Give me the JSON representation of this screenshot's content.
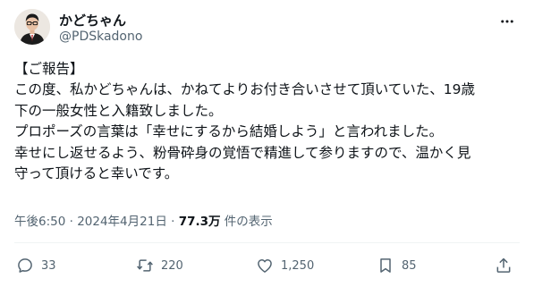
{
  "author": {
    "display_name": "かどちゃん",
    "handle": "@PDSkadono",
    "avatar_icon": "profile-photo-icon"
  },
  "tweet": {
    "lines": [
      "【ご報告】",
      "この度、私かどちゃんは、かねてよりお付き合いさせて頂いていた、19歳",
      "下の一般女性と入籍致しました。",
      "プロポーズの言葉は「幸せにするから結婚しよう」と言われました。",
      "幸せにし返せるよう、粉骨砕身の覚悟で精進して参りますので、温かく見",
      "守って頂けると幸いです。"
    ]
  },
  "meta": {
    "timestamp": "午後6:50 · 2024年4月21日",
    "separator": " · ",
    "views": "77.3万",
    "views_label": " 件の表示"
  },
  "actions": {
    "replies": "33",
    "reposts": "220",
    "likes": "1,250",
    "bookmarks": "85"
  },
  "colors": {
    "text": "#0f1419",
    "secondary": "#536471",
    "divider": "#eff3f4"
  }
}
